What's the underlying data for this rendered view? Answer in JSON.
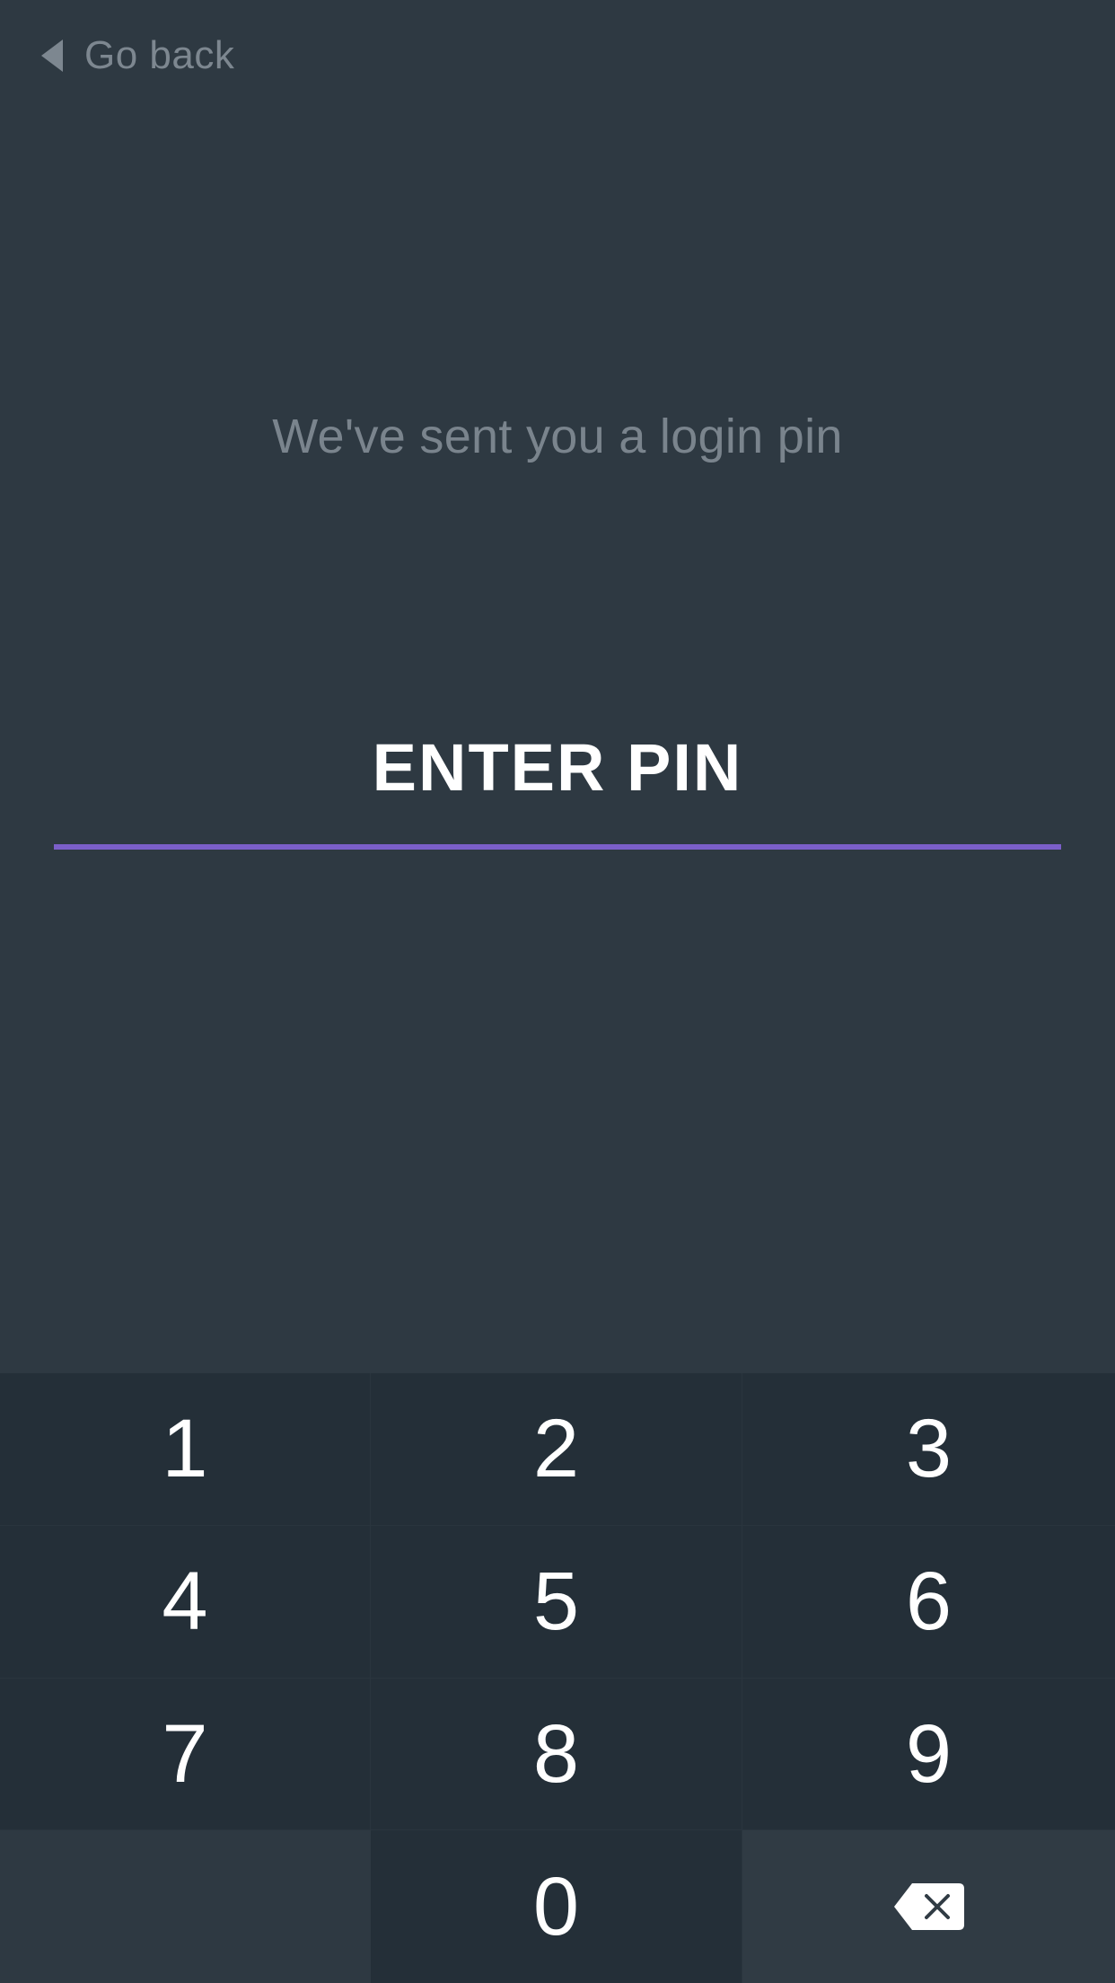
{
  "header": {
    "back_label": "Go back",
    "back_icon": "chevron-left-icon"
  },
  "main": {
    "subtitle": "We've sent you a login pin",
    "pin_title": "ENTER PIN"
  },
  "keypad": {
    "keys": [
      "1",
      "2",
      "3",
      "4",
      "5",
      "6",
      "7",
      "8",
      "9",
      "0"
    ],
    "delete_icon": "backspace-icon"
  },
  "colors": {
    "background": "#2e3942",
    "keypad_key": "#242f38",
    "accent_underline": "#7b5fc9",
    "muted_text": "#7d8790",
    "primary_text": "#ffffff"
  }
}
